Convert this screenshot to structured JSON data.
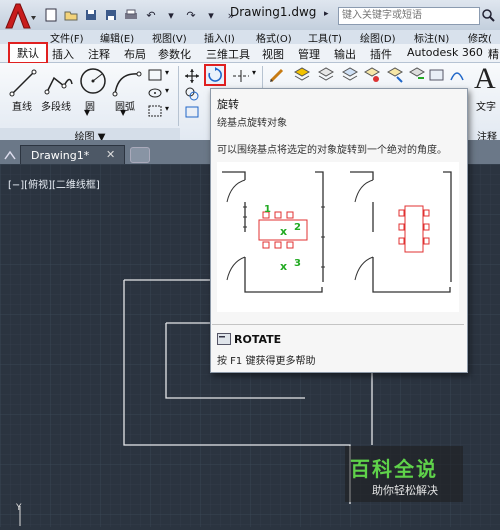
{
  "titlebar": {
    "document_title": "Drawing1.dwg",
    "search_placeholder": "键入关键字或短语"
  },
  "menubar": {
    "items": [
      "文件(F)",
      "编辑(E)",
      "视图(V)",
      "插入(I)",
      "格式(O)",
      "工具(T)",
      "绘图(D)",
      "标注(N)",
      "修改("
    ]
  },
  "ribbon": {
    "tabs": [
      "默认",
      "插入",
      "注释",
      "布局",
      "参数化",
      "三维工具",
      "视图",
      "管理",
      "输出",
      "插件",
      "Autodesk 360",
      "精"
    ],
    "active_tab": "默认",
    "tools": {
      "line": "直线",
      "polyline": "多段线",
      "circle": "圆",
      "arc": "圆弧",
      "text": "文字",
      "text_glyph": "A"
    },
    "panels": {
      "draw": "绘图 ▼",
      "annotation": "注释"
    }
  },
  "file_tabs": {
    "active": "Drawing1*"
  },
  "viewport": {
    "label": "[−][俯视][二维线框]"
  },
  "tooltip": {
    "title": "旋转",
    "subtitle": "绕基点旋转对象",
    "description": "可以围绕基点将选定的对象旋转到一个绝对的角度。",
    "command": "ROTATE",
    "help": "按 F1 键获得更多帮助",
    "illustration_labels": [
      "1",
      "2",
      "3"
    ]
  },
  "watermark": {
    "title": "百科全说",
    "subtitle": "助你轻松解决"
  },
  "colors": {
    "highlight": "#e02020",
    "canvas": "#2b3440",
    "accent_green": "#22aa22"
  }
}
